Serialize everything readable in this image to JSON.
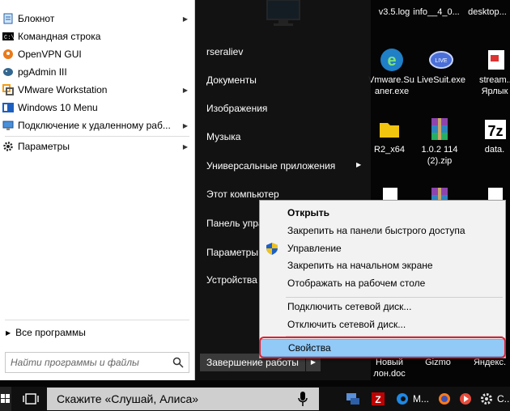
{
  "desktop": {
    "icons": [
      {
        "label": "v3.5.log",
        "icon": "text-file-icon"
      },
      {
        "label": "info__4_0...",
        "icon": "text-file-icon"
      },
      {
        "label": "desktop...",
        "icon": "text-file-icon"
      },
      {
        "label": "Vmware.Su... aner.exe",
        "line1": "Vmware.Su...",
        "line2": "aner.exe",
        "icon": "app-e-icon"
      },
      {
        "label": "LiveSuit.exe",
        "icon": "livesuit-icon"
      },
      {
        "label": "stream... Ярлык",
        "line1": "stream...",
        "line2": "Ярлык",
        "icon": "shortcut-icon"
      },
      {
        "label": "R2_x64",
        "icon": "folder-icon"
      },
      {
        "label": "1.0.2 114 (2).zip",
        "line1": "1.0.2 114",
        "line2": "(2).zip",
        "icon": "winrar-icon"
      },
      {
        "label": "data.7z",
        "line1": "data.",
        "icon": "7zip-icon"
      },
      {
        "label": "Новый ...лон.doc",
        "line1": "Новый",
        "line2": "лон.doc",
        "icon": "word-doc-icon"
      },
      {
        "label": "Gizmo",
        "icon": "app-icon"
      },
      {
        "label": "Яндекс.",
        "icon": "yandex-icon"
      }
    ]
  },
  "start_menu": {
    "items": [
      {
        "label": "Блокнот",
        "icon": "notepad-icon",
        "has_submenu": true
      },
      {
        "label": "Командная строка",
        "icon": "cmd-icon",
        "has_submenu": false
      },
      {
        "label": "OpenVPN GUI",
        "icon": "openvpn-icon",
        "has_submenu": false
      },
      {
        "label": "pgAdmin III",
        "icon": "pgadmin-icon",
        "has_submenu": false
      },
      {
        "label": "VMware Workstation",
        "icon": "vmware-icon",
        "has_submenu": true
      },
      {
        "label": "Windows 10 Menu",
        "icon": "windows10menu-icon",
        "has_submenu": false
      },
      {
        "label": "Подключение к удаленному раб...",
        "icon": "remote-desktop-icon",
        "has_submenu": true
      },
      {
        "label": "Параметры",
        "icon": "gear-icon",
        "has_submenu": true
      }
    ],
    "all_programs": "Все программы",
    "search_placeholder": "Найти программы и файлы",
    "right_panel": [
      {
        "label": "rseraliev"
      },
      {
        "label": "Документы"
      },
      {
        "label": "Изображения"
      },
      {
        "label": "Музыка"
      },
      {
        "label": "Универсальные приложения",
        "has_submenu": true
      },
      {
        "label": "Этот компьютер"
      },
      {
        "label": "Панель упра..."
      },
      {
        "label": "Параметры"
      },
      {
        "label": "Устройства и..."
      }
    ],
    "shutdown_label": "Завершение работы"
  },
  "context_menu": {
    "items": [
      {
        "label": "Открыть",
        "bold": true
      },
      {
        "label": "Закрепить на панели быстрого доступа"
      },
      {
        "label": "Управление",
        "icon": "uac-shield-icon"
      },
      {
        "label": "Закрепить на начальном экране"
      },
      {
        "label": "Отображать на рабочем столе"
      },
      {
        "label": "Подключить сетевой диск..."
      },
      {
        "label": "Отключить сетевой диск..."
      },
      {
        "label": "Свойства",
        "highlighted": true
      }
    ]
  },
  "taskbar": {
    "search_text": "Скажите «Слушай, Алиса»",
    "apps": [
      {
        "label": "",
        "icon": "network-app-icon"
      },
      {
        "label": "",
        "icon": "filezilla-icon"
      },
      {
        "label": "M...",
        "icon": "edge-icon"
      },
      {
        "label": "",
        "icon": "firefox-icon"
      },
      {
        "label": "",
        "icon": "media-player-icon"
      },
      {
        "label": "C...",
        "icon": "settings-icon"
      }
    ]
  },
  "colors": {
    "highlight": "#91c9f7",
    "highlight_ring": "#e02030",
    "taskbar_bg": "#101010",
    "start_left_bg": "#ffffff"
  }
}
